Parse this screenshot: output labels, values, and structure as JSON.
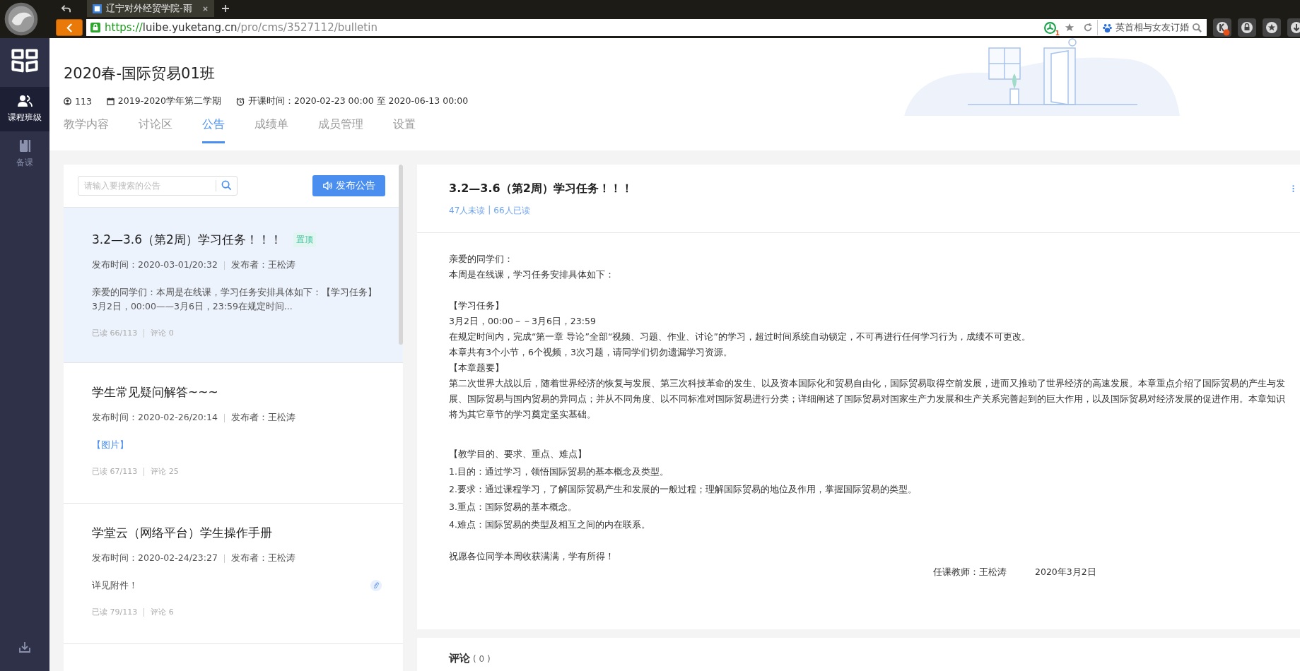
{
  "browser": {
    "tab_title": "辽宁对外经贸学院-雨",
    "url": {
      "scheme": "https://",
      "host": "luibe.yuketang.cn",
      "path": "/pro/cms/3527112/bulletin"
    },
    "addon_badge": "1",
    "search_text": "英首相与女友订婚"
  },
  "sidebar": {
    "items": [
      {
        "label": "课程班级",
        "selected": true,
        "kind": "class"
      },
      {
        "label": "备课",
        "selected": false,
        "kind": "book"
      }
    ]
  },
  "course": {
    "title": "2020春-国际贸易01班",
    "students": "113",
    "term": "2019-2020学年第二学期",
    "schedule": "开课时间：2020-02-23 00:00 至 2020-06-13 00:00"
  },
  "tabs": [
    {
      "label": "教学内容",
      "selected": false
    },
    {
      "label": "讨论区",
      "selected": false
    },
    {
      "label": "公告",
      "selected": true
    },
    {
      "label": "成绩单",
      "selected": false
    },
    {
      "label": "成员管理",
      "selected": false
    },
    {
      "label": "设置",
      "selected": false
    }
  ],
  "bulletins": {
    "search": {
      "placeholder": "请输入要搜索的公告"
    },
    "publish_button": "发布公告",
    "items": [
      {
        "title": "3.2—3.6（第2周）学习任务！！！",
        "badge": "置顶",
        "time": "发布时间：2020-03-01/20:32",
        "author": "发布者：王松涛",
        "preview": "亲爱的同学们：本周是在线课，学习任务安排具体如下：【学习任务】3月2日，00:00——3月6日，23:59在规定时间...",
        "preview_link": false,
        "read": "已读 66/113",
        "comments": "评论 0",
        "attachment": false,
        "selected": true
      },
      {
        "title": "学生常见疑问解答~~~",
        "time": "发布时间：2020-02-26/20:14",
        "author": "发布者：王松涛",
        "preview": "【图片】",
        "preview_link": true,
        "read": "已读 67/113",
        "comments": "评论 25",
        "attachment": false,
        "selected": false
      },
      {
        "title": "学堂云（网络平台）学生操作手册",
        "time": "发布时间：2020-02-24/23:27",
        "author": "发布者：王松涛",
        "preview": "详见附件！",
        "preview_link": false,
        "read": "已读 79/113",
        "comments": "评论 6",
        "attachment": true,
        "selected": false
      }
    ]
  },
  "detail": {
    "title": "3.2—3.6（第2周）学习任务！！！",
    "unread": "47人未读",
    "read": "66人已读",
    "separator": "|",
    "blocks": [
      [
        "亲爱的同学们：",
        "本周是在线课，学习任务安排具体如下："
      ],
      [
        "【学习任务】",
        "3月2日，00:00－－3月6日，23:59",
        "在规定时间内，完成“第一章 导论”全部“视频、习题、作业、讨论”的学习，超过时间系统自动锁定，不可再进行任何学习行为，成绩不可更改。",
        "本章共有3个小节，6个视频，3次习题，请同学们切勿遗漏学习资源。",
        "【本章题要】",
        "第二次世界大战以后，随着世界经济的恢复与发展、第三次科技革命的发生、以及资本国际化和贸易自由化，国际贸易取得空前发展，进而又推动了世界经济的高速发展。本章重点介绍了国际贸易的产生与发展、国际贸易与国内贸易的异同点；并从不同角度、以不同标准对国际贸易进行分类；详细阐述了国际贸易对国家生产力发展和生产关系完善起到的巨大作用，以及国际贸易对经济发展的促进作用。本章知识将为其它章节的学习奠定坚实基础。"
      ],
      [
        "【教学目的、要求、重点、难点】",
        "1.目的：通过学习，领悟国际贸易的基本概念及类型。",
        "2.要求：通过课程学习，了解国际贸易产生和发展的一般过程；理解国际贸易的地位及作用，掌握国际贸易的类型。",
        "3.重点：国际贸易的基本概念。",
        "4.难点：国际贸易的类型及相互之间的内在联系。"
      ],
      [
        "祝愿各位同学本周收获满满，学有所得！"
      ]
    ],
    "signature": {
      "teacher": "任课教师：王松涛",
      "date": "2020年3月2日"
    }
  },
  "comments": {
    "heading": "评论",
    "count": "( 0 )"
  }
}
